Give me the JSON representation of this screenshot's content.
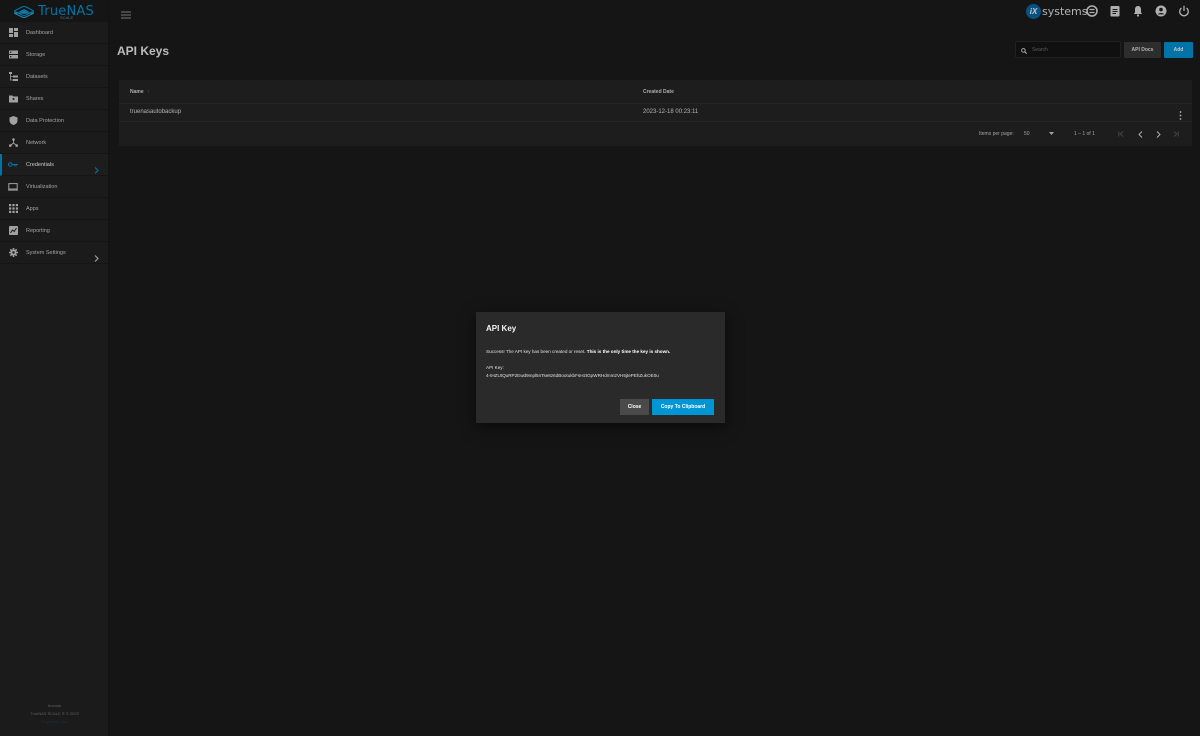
{
  "brand": {
    "name": "TrueNAS",
    "edition": "SCALE"
  },
  "header": {
    "vendor_logo": "iX systems",
    "vendor_text": "systems",
    "vendor_mark": "iX",
    "icons": [
      "truecommand-icon",
      "clipboard-icon",
      "bell-icon",
      "account-icon",
      "power-icon"
    ]
  },
  "sidebar": {
    "items": [
      {
        "label": "Dashboard",
        "icon": "dashboard-icon"
      },
      {
        "label": "Storage",
        "icon": "storage-icon"
      },
      {
        "label": "Datasets",
        "icon": "datasets-icon"
      },
      {
        "label": "Shares",
        "icon": "shares-icon"
      },
      {
        "label": "Data Protection",
        "icon": "shield-icon"
      },
      {
        "label": "Network",
        "icon": "network-icon"
      },
      {
        "label": "Credentials",
        "icon": "key-icon",
        "active": true,
        "has_children": true
      },
      {
        "label": "Virtualization",
        "icon": "monitor-icon"
      },
      {
        "label": "Apps",
        "icon": "apps-icon"
      },
      {
        "label": "Reporting",
        "icon": "reporting-icon"
      },
      {
        "label": "System Settings",
        "icon": "gear-icon",
        "has_children": true
      }
    ],
    "footer": {
      "hostname": "truenas",
      "version": "TrueNAS SCALE ® © 2023",
      "company": "iXsystems, Inc."
    }
  },
  "main": {
    "title": "API Keys",
    "search_placeholder": "Search",
    "api_docs_label": "API Docs",
    "add_label": "Add",
    "table": {
      "columns": [
        "Name",
        "Created Date"
      ],
      "sort_indicator": "↑",
      "rows": [
        {
          "name": "truenasautobackup",
          "created": "2023-12-18 00:23:11"
        }
      ]
    },
    "paginator": {
      "items_per_page_label": "Items per page:",
      "page_size": "50",
      "range": "1 – 1 of 1"
    }
  },
  "dialog": {
    "title": "API Key",
    "message": "Success! The API key has been created or reset.",
    "message_bold": "This is the only time the key is shown.",
    "key_label": "API Key:",
    "key_value": "4-tHZUtQuRP2Ewd9mpl5nTse8z6dBootukbFsHztGpWRHdmm2VH5jtePEhZukOE0u",
    "close_label": "Close",
    "copy_label": "Copy To Clipboard"
  },
  "colors": {
    "accent": "#0095d5",
    "background": "#1b1b1b",
    "sidebar": "#232323",
    "card": "#262626",
    "dialog": "#2a2a2a"
  }
}
